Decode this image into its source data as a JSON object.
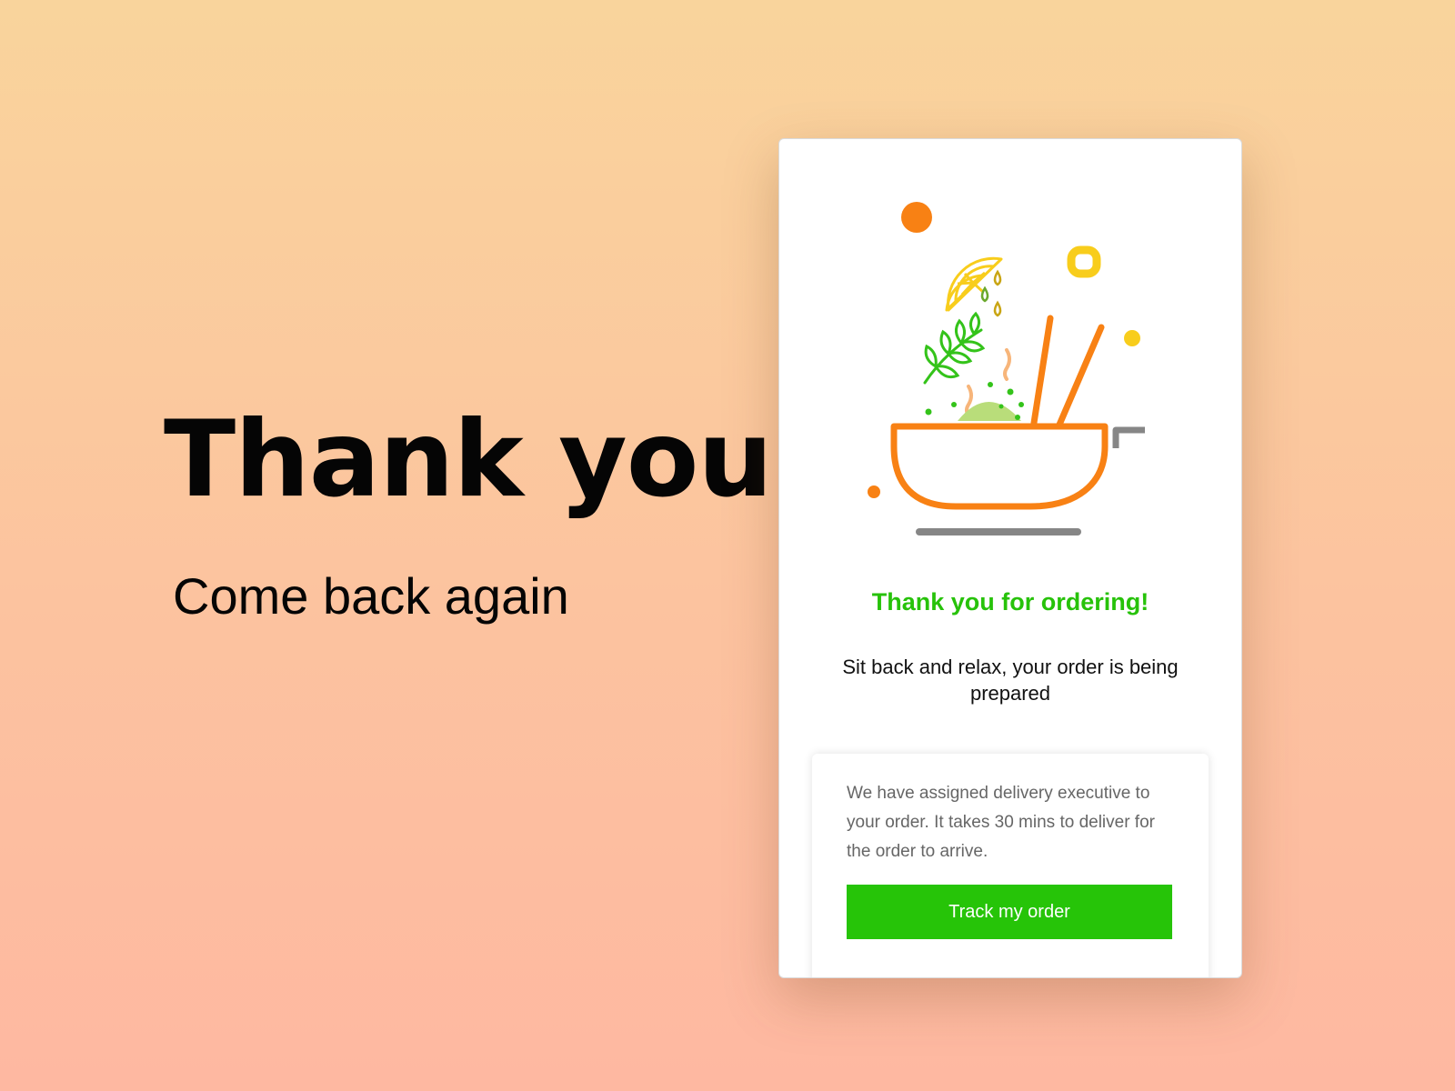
{
  "hero": {
    "title": "Thank you",
    "subtitle": "Come back again"
  },
  "card": {
    "heading": "Thank you for ordering!",
    "message": "Sit back and relax, your order is being prepared",
    "info": "We have assigned delivery executive to your order. It takes 30 mins to deliver for the order to arrive.",
    "button_label": "Track my order"
  },
  "illustration": {
    "name": "food-bowl-illustration",
    "icons": [
      "bowl-icon",
      "chopsticks-icon",
      "lemon-slice-icon",
      "leaf-sprig-icon",
      "pan-handle-icon"
    ]
  },
  "colors": {
    "accent_green": "#26c408",
    "bowl_orange": "#f88114",
    "lemon_yellow": "#f8cd1c",
    "handle_gray": "#868686",
    "background_top": "#f9d49c",
    "background_bottom": "#feb8a1"
  }
}
